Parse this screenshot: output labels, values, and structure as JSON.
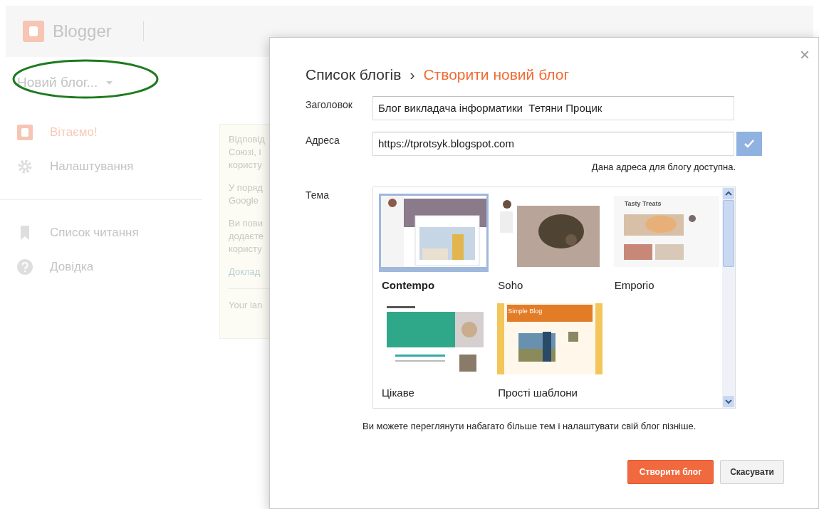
{
  "app": {
    "logo_text": "Blogger",
    "blog_selector": "Новий блог..."
  },
  "sidebar": {
    "items": [
      {
        "label": "Вітаємо!",
        "kind": "welcome",
        "selected": true
      },
      {
        "label": "Налаштування",
        "kind": "settings",
        "selected": false
      },
      {
        "label": "Список читання",
        "kind": "reading",
        "selected": false
      },
      {
        "label": "Довідка",
        "kind": "help",
        "selected": false
      }
    ]
  },
  "notice": {
    "paragraphs": [
      [
        "Відповід",
        "Союзі, і",
        "користу"
      ],
      [
        "У поряд",
        "Google"
      ],
      [
        "Ви пови",
        "додаєте",
        "користу"
      ]
    ],
    "link": "Доклад",
    "footer": "Your lan"
  },
  "dialog": {
    "breadcrumb": "Список блогів",
    "separator": "›",
    "title": "Створити новий блог",
    "title_label": "Заголовок",
    "title_value": "Блог викладача інформатики  Тетяни Процик",
    "address_label": "Адреса",
    "address_value": "https://tprotsyk.blogspot.com",
    "address_status": "Дана адреса для блогу доступна.",
    "address_ok": true,
    "theme_label": "Тема",
    "themes": [
      {
        "name": "Contempo",
        "kind": "contempo",
        "selected": true
      },
      {
        "name": "Soho",
        "kind": "soho",
        "selected": false
      },
      {
        "name": "Emporio",
        "kind": "emporio",
        "selected": false,
        "preview_title": "Tasty Treats"
      },
      {
        "name": "Цікаве",
        "kind": "notable",
        "selected": false
      },
      {
        "name": "Прості шаблони",
        "kind": "simple",
        "selected": false,
        "preview_title": "Simple Blog"
      }
    ],
    "hint": "Ви можете переглянути набагато більше тем і налаштувати свій блог пізніше.",
    "create_button": "Створити блог",
    "cancel_button": "Скасувати",
    "close": "×"
  }
}
